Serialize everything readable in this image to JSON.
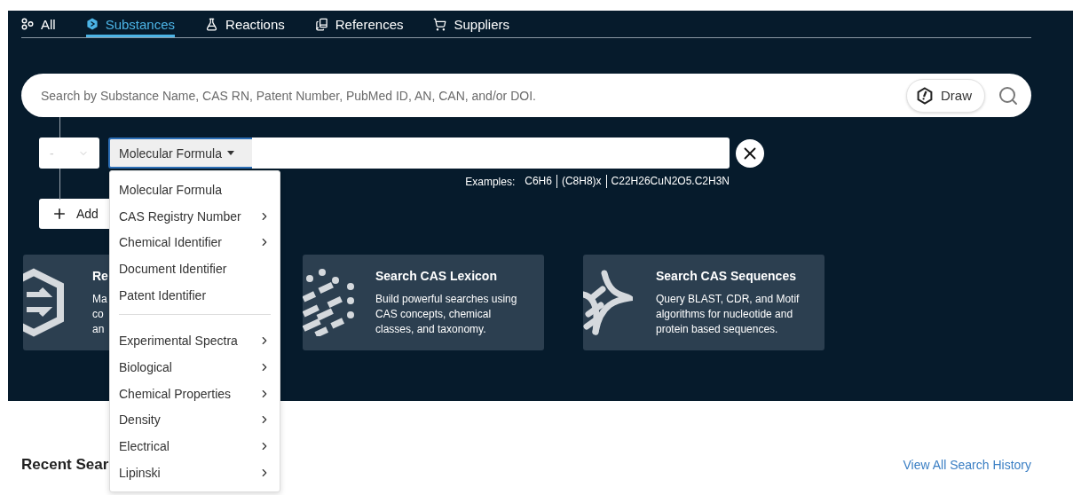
{
  "tabs": [
    {
      "label": "All",
      "selected": false
    },
    {
      "label": "Substances",
      "selected": true
    },
    {
      "label": "Reactions",
      "selected": false
    },
    {
      "label": "References",
      "selected": false
    },
    {
      "label": "Suppliers",
      "selected": false
    }
  ],
  "search": {
    "placeholder": "Search by Substance Name, CAS RN, Patent Number, PubMed ID, AN, CAN, and/or DOI.",
    "draw_button": "Draw"
  },
  "query": {
    "operator": "-",
    "field": "Molecular Formula",
    "examples_label": "Examples:",
    "examples": [
      "C6H6",
      "(C8H8)x",
      "C22H26CuN2O5.C2H3N"
    ],
    "add_button": "Add"
  },
  "field_menu": [
    {
      "kind": "item",
      "label": "Molecular Formula",
      "submenu": false
    },
    {
      "kind": "item",
      "label": "CAS Registry Number",
      "submenu": true
    },
    {
      "kind": "item",
      "label": "Chemical Identifier",
      "submenu": true
    },
    {
      "kind": "item",
      "label": "Document Identifier",
      "submenu": false
    },
    {
      "kind": "item",
      "label": "Patent Identifier",
      "submenu": false
    },
    {
      "kind": "divider"
    },
    {
      "kind": "item",
      "label": "Experimental Spectra",
      "submenu": true
    },
    {
      "kind": "item",
      "label": "Biological",
      "submenu": true
    },
    {
      "kind": "item",
      "label": "Chemical Properties",
      "submenu": true
    },
    {
      "kind": "item",
      "label": "Density",
      "submenu": true
    },
    {
      "kind": "item",
      "label": "Electrical",
      "submenu": true
    },
    {
      "kind": "item",
      "label": "Lipinski",
      "submenu": true
    }
  ],
  "cards": [
    {
      "title": "Re",
      "description": [
        "Ma",
        "co",
        "an"
      ]
    },
    {
      "title": "Search CAS Lexicon",
      "description": [
        "Build powerful searches using",
        "CAS concepts, chemical",
        "classes, and taxonomy."
      ]
    },
    {
      "title": "Search CAS Sequences",
      "description": [
        "Query BLAST, CDR, and Motif",
        "algorithms for nucleotide and",
        "protein based sequences."
      ]
    }
  ],
  "recent": {
    "title": "Recent Sear",
    "link": "View All Search History"
  }
}
